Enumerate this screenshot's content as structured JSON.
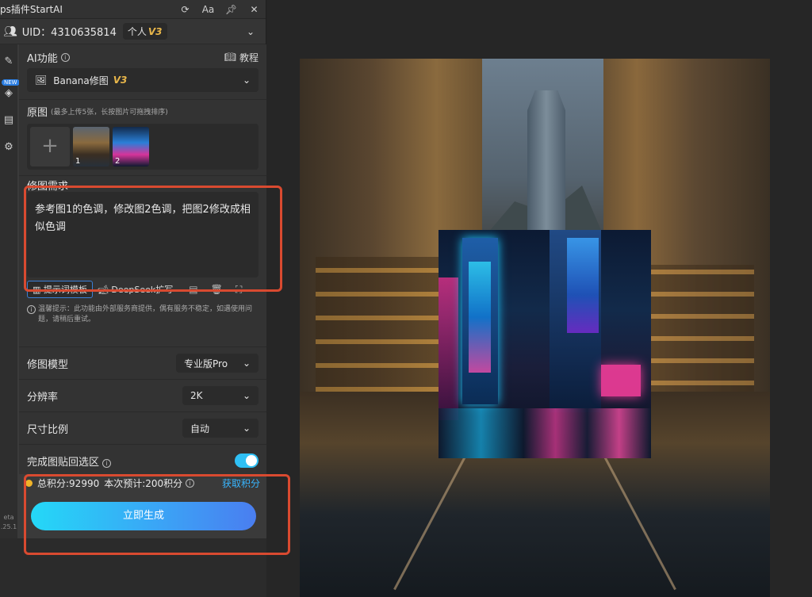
{
  "window": {
    "title": "ps插件StartAI",
    "icons": [
      "refresh-icon",
      "font-icon",
      "pin-icon",
      "close-icon"
    ],
    "font_icon_label": "Aa"
  },
  "user": {
    "uid_label": "UID：4310635814",
    "plan": "个人",
    "plan_version": "V3"
  },
  "rail": {
    "new_badge": "NEW",
    "beta_label": "eta",
    "version_label": ".25.1"
  },
  "ai_function": {
    "label": "AI功能",
    "tutorial": "教程",
    "selected": "Banana修图",
    "selected_version": "V3"
  },
  "source_images": {
    "label": "原图",
    "hint": "(最多上传5张，长按图片可拖拽排序)",
    "add_symbol": "+",
    "thumbs": [
      {
        "index": "1"
      },
      {
        "index": "2"
      }
    ]
  },
  "prompt": {
    "label": "修图需求",
    "text": "参考图1的色调，修改图2色调，把图2修改成相似色调",
    "template_button": "提示词模板",
    "deepseek_button": "DeepSeek扩写",
    "notice": "温馨提示：此功能由外部服务商提供，偶有服务不稳定，如遇使用问题，请稍后重试。"
  },
  "settings": {
    "model": {
      "label": "修图模型",
      "value": "专业版Pro"
    },
    "resolution": {
      "label": "分辨率",
      "value": "2K"
    },
    "aspect": {
      "label": "尺寸比例",
      "value": "自动"
    },
    "paste_back": {
      "label": "完成图贴回选区",
      "enabled": true
    }
  },
  "footer": {
    "total_credits": "总积分:92990",
    "estimate": "本次预计:200积分",
    "get_credits": "获取积分",
    "generate": "立即生成"
  },
  "colors": {
    "accent_blue": "#38b6ff",
    "highlight_red": "#d94a30",
    "gold": "#e8b64a"
  }
}
